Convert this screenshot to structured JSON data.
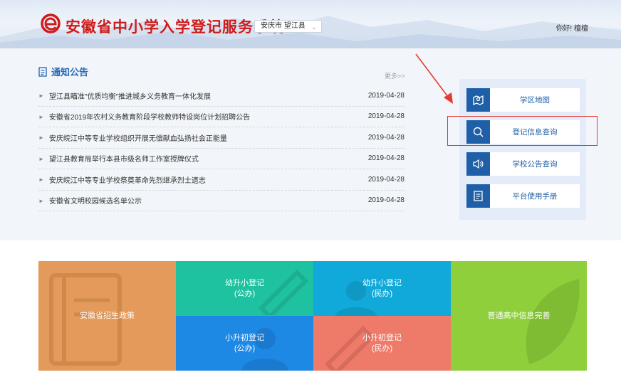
{
  "header": {
    "site_title": "安徽省中小学入学登记服务系统",
    "region_select": "安庆市 望江县",
    "greeting": "你好! 檀檀"
  },
  "notices": {
    "title": "通知公告",
    "more": "更多>>",
    "items": [
      {
        "text": "望江县瞄准\"优质均衡\"推进城乡义务教育一体化发展",
        "date": "2019-04-28"
      },
      {
        "text": "安徽省2019年农村义务教育阶段学校教师特设岗位计划招聘公告",
        "date": "2019-04-28"
      },
      {
        "text": "安庆皖江中等专业学校组织开展无偿献血弘扬社会正能量",
        "date": "2019-04-28"
      },
      {
        "text": "望江县教育局举行本县市级名师工作室授牌仪式",
        "date": "2019-04-28"
      },
      {
        "text": "安庆皖江中等专业学校祭奠革命先烈继承烈士遗志",
        "date": "2019-04-28"
      },
      {
        "text": "安徽省文明校园候选名单公示",
        "date": "2019-04-28"
      }
    ]
  },
  "quick_links": [
    {
      "label": "学区地图",
      "icon": "map-icon"
    },
    {
      "label": "登记信息查询",
      "icon": "search-icon"
    },
    {
      "label": "学校公告查询",
      "icon": "speaker-icon"
    },
    {
      "label": "平台使用手册",
      "icon": "manual-icon"
    }
  ],
  "tiles": {
    "policy": "安徽省招生政策",
    "primary_public": [
      "幼升小登记",
      "(公办)"
    ],
    "primary_private": [
      "幼升小登记",
      "(民办)"
    ],
    "junior_public": [
      "小升初登记",
      "(公办)"
    ],
    "junior_private": [
      "小升初登记",
      "(民办)"
    ],
    "high_school": "普通高中信息完善"
  },
  "colors": {
    "brand_red": "#cf1b1b",
    "brand_blue": "#1f5fa8",
    "tile_orange": "#e39a5a",
    "tile_teal": "#1fc2a0",
    "tile_cyan": "#10a9d9",
    "tile_blue": "#1e88e5",
    "tile_salmon": "#ee7b6a",
    "tile_green": "#8fcf3b"
  }
}
